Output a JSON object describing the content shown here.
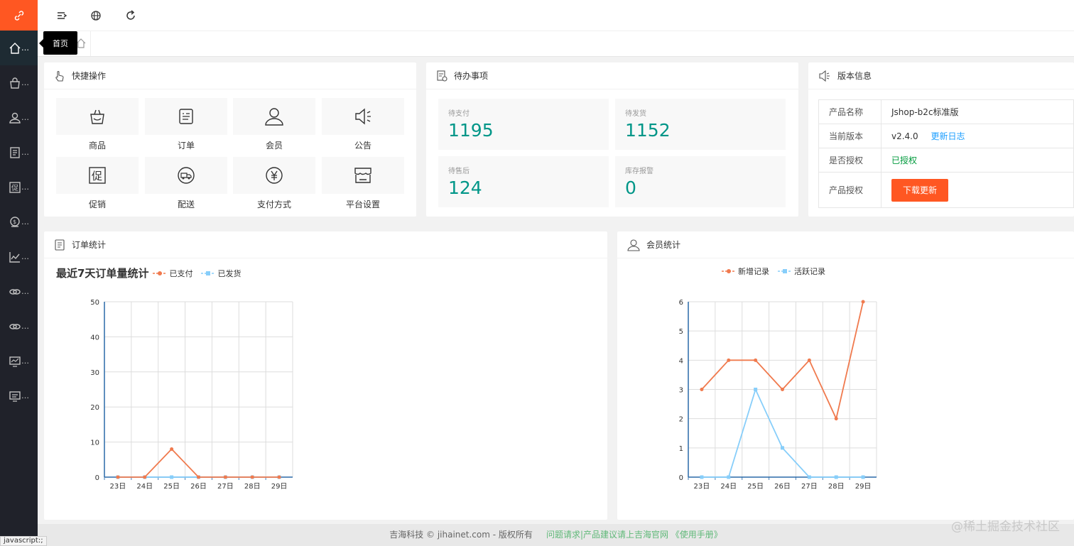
{
  "sidebar": {
    "items": [
      {
        "icon": "home-icon",
        "label": "…"
      },
      {
        "icon": "bag-icon",
        "label": "…"
      },
      {
        "icon": "user-icon",
        "label": "…"
      },
      {
        "icon": "document-icon",
        "label": "…"
      },
      {
        "icon": "promo-icon",
        "label": "…"
      },
      {
        "icon": "money-icon",
        "label": "…"
      },
      {
        "icon": "chart-icon",
        "label": "…"
      },
      {
        "icon": "link-icon",
        "label": "…"
      },
      {
        "icon": "link-icon",
        "label": "…"
      },
      {
        "icon": "monitor-icon",
        "label": "…"
      },
      {
        "icon": "monitor-icon",
        "label": "…"
      }
    ]
  },
  "tooltip": "首页",
  "quick": {
    "title": "快捷操作",
    "items": [
      "商品",
      "订单",
      "会员",
      "公告",
      "促销",
      "配送",
      "支付方式",
      "平台设置"
    ]
  },
  "todo": {
    "title": "待办事项",
    "items": [
      {
        "label": "待支付",
        "value": "1195"
      },
      {
        "label": "待发货",
        "value": "1152"
      },
      {
        "label": "待售后",
        "value": "124"
      },
      {
        "label": "库存报警",
        "value": "0"
      }
    ]
  },
  "version": {
    "title": "版本信息",
    "rows": {
      "name_key": "产品名称",
      "name_val": "Jshop-b2c标准版",
      "ver_key": "当前版本",
      "ver_val": "v2.4.0",
      "changelog": "更新日志",
      "auth_key": "是否授权",
      "auth_val": "已授权",
      "lic_key": "产品授权",
      "download": "下载更新"
    }
  },
  "order_stats": {
    "title": "订单统计"
  },
  "member_stats": {
    "title": "会员统计"
  },
  "chart_data": [
    {
      "type": "line",
      "title": "最近7天订单量统计",
      "categories": [
        "23日",
        "24日",
        "25日",
        "26日",
        "27日",
        "28日",
        "29日"
      ],
      "series": [
        {
          "name": "已支付",
          "values": [
            0,
            0,
            8,
            0,
            0,
            0,
            0
          ],
          "color": "#f07a4e"
        },
        {
          "name": "已发货",
          "values": [
            0,
            0,
            0,
            0,
            0,
            0,
            0
          ],
          "color": "#87cefa"
        }
      ],
      "ylim": [
        0,
        50
      ],
      "yticks": [
        0,
        10,
        20,
        30,
        40,
        50
      ],
      "grid": true,
      "legend": "top"
    },
    {
      "type": "line",
      "title": "",
      "categories": [
        "23日",
        "24日",
        "25日",
        "26日",
        "27日",
        "28日",
        "29日"
      ],
      "series": [
        {
          "name": "新增记录",
          "values": [
            3,
            4,
            4,
            3,
            4,
            2,
            6
          ],
          "color": "#f07a4e"
        },
        {
          "name": "活跃记录",
          "values": [
            0,
            0,
            3,
            1,
            0,
            0,
            0
          ],
          "color": "#87cefa"
        }
      ],
      "ylim": [
        0,
        6
      ],
      "yticks": [
        0,
        1,
        2,
        3,
        4,
        5,
        6
      ],
      "grid": true,
      "legend": "top"
    }
  ],
  "footer": {
    "copyright": "吉海科技 © jihainet.com - 版权所有",
    "links": "问题请求|产品建议请上吉海官网 《使用手册》"
  },
  "status_bar": "javascript:;",
  "watermark": "@稀土掘金技术社区"
}
